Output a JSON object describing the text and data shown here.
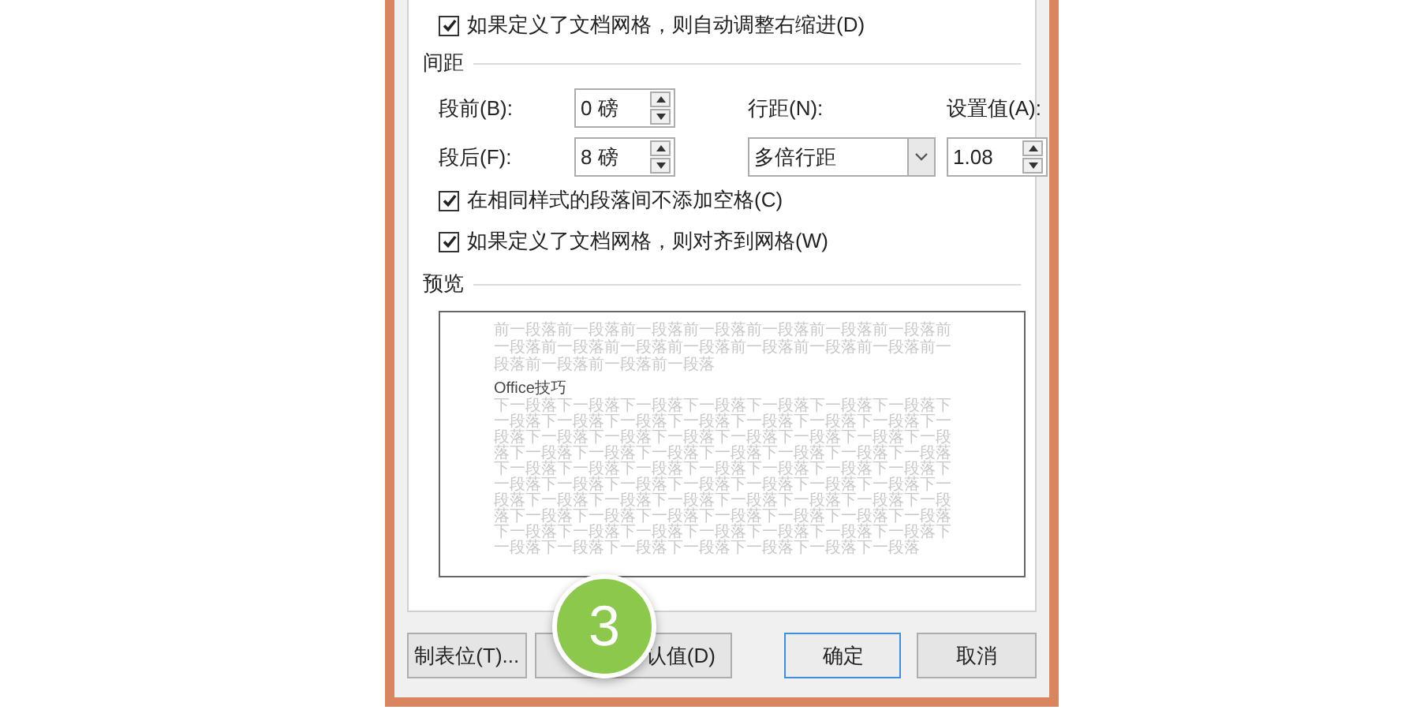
{
  "checkbox_top": {
    "label": "如果定义了文档网格，则自动调整右缩进(D)",
    "checked": true
  },
  "spacing": {
    "heading": "间距",
    "before": {
      "label": "段前(B):",
      "value": "0 磅"
    },
    "after": {
      "label": "段后(F):",
      "value": "8 磅"
    },
    "line_spacing": {
      "label": "行距(N):",
      "value": "多倍行距"
    },
    "at": {
      "label": "设置值(A):",
      "value": "1.08"
    },
    "options": [
      {
        "label": "在相同样式的段落间不添加空格(C)",
        "checked": true
      },
      {
        "label": "如果定义了文档网格，则对齐到网格(W)",
        "checked": true
      }
    ]
  },
  "preview": {
    "heading": "预览",
    "previous_text": "前一段落前一段落前一段落前一段落前一段落前一段落前一段落前一段落前一段落前一段落前一段落前一段落前一段落前一段落前一段落前一段落前一段落前一段落",
    "sample_text": "Office技巧",
    "following_text": "下一段落下一段落下一段落下一段落下一段落下一段落下一段落下一段落下一段落下一段落下一段落下一段落下一段落下一段落下一段落下一段落下一段落下一段落下一段落下一段落下一段落下一段落下一段落下一段落下一段落下一段落下一段落下一段落下一段落下一段落下一段落下一段落下一段落下一段落下一段落下一段落下一段落下一段落下一段落下一段落下一段落下一段落下一段落下一段落下一段落下一段落下一段落下一段落下一段落下一段落下一段落下一段落下一段落下一段落下一段落下一段落下一段落下一段落下一段落下一段落下一段落下一段落下一段落下一段落下一段落下一段落下一段落下一段落下一段落下一段落下一段落下一段落"
  },
  "buttons": [
    {
      "label": "制表位(T)...",
      "kind": "plain"
    },
    {
      "label": "认值(D)",
      "kind": "default-setter"
    },
    {
      "label": "确定",
      "kind": "primary"
    },
    {
      "label": "取消",
      "kind": "plain"
    }
  ],
  "step_badge": "3"
}
